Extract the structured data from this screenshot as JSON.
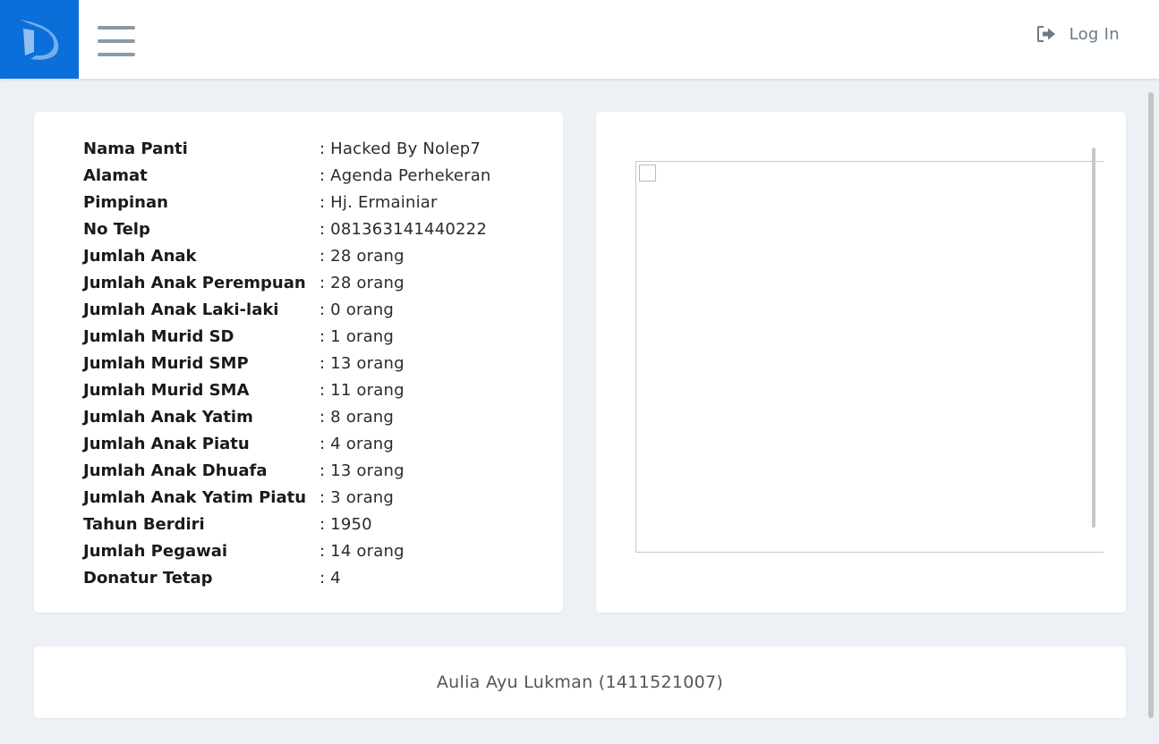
{
  "header": {
    "logo_icon": "d-logo-icon",
    "menu_icon": "hamburger-menu-icon",
    "login_icon": "sign-in-icon",
    "login_label": "Log In",
    "colors": {
      "logo_bg": "#0b6fd9",
      "topbar_bg": "#ffffff"
    }
  },
  "info": {
    "rows": [
      {
        "label": "Nama Panti",
        "value": ": Hacked By Nolep7"
      },
      {
        "label": "Alamat",
        "value": ": Agenda Perhekeran"
      },
      {
        "label": "Pimpinan",
        "value": ": Hj. Ermainiar"
      },
      {
        "label": "No Telp",
        "value": ": 081363141440222"
      },
      {
        "label": "Jumlah Anak",
        "value": ": 28 orang"
      },
      {
        "label": "Jumlah Anak Perempuan",
        "value": ": 28 orang"
      },
      {
        "label": "Jumlah Anak Laki-laki",
        "value": ": 0 orang"
      },
      {
        "label": "Jumlah Murid SD",
        "value": ": 1 orang"
      },
      {
        "label": "Jumlah Murid SMP",
        "value": ": 13 orang"
      },
      {
        "label": "Jumlah Murid SMA",
        "value": ": 11 orang"
      },
      {
        "label": "Jumlah Anak Yatim",
        "value": ": 8 orang"
      },
      {
        "label": "Jumlah Anak Piatu",
        "value": ": 4 orang"
      },
      {
        "label": "Jumlah Anak Dhuafa",
        "value": ": 13 orang"
      },
      {
        "label": "Jumlah Anak Yatim Piatu",
        "value": ": 3 orang"
      },
      {
        "label": "Tahun Berdiri",
        "value": ": 1950"
      },
      {
        "label": "Jumlah Pegawai",
        "value": ": 14 orang"
      },
      {
        "label": "Donatur Tetap",
        "value": ": 4"
      }
    ]
  },
  "map": {
    "broken_image_icon": "broken-image-icon"
  },
  "footer": {
    "text": "Aulia Ayu Lukman (1411521007)"
  }
}
